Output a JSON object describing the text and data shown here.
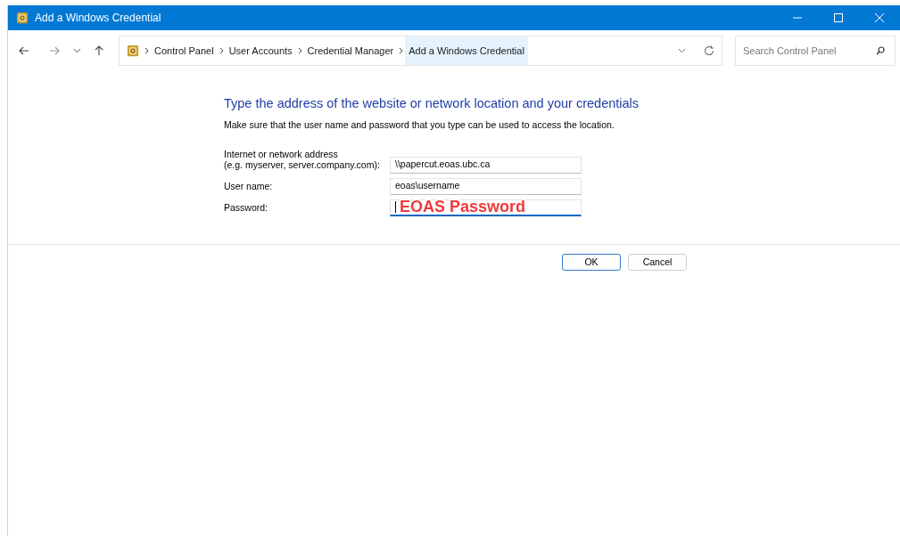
{
  "window": {
    "title": "Add a Windows Credential"
  },
  "breadcrumb": [
    {
      "label": "Control Panel",
      "selected": false
    },
    {
      "label": "User Accounts",
      "selected": false
    },
    {
      "label": "Credential Manager",
      "selected": false
    },
    {
      "label": "Add a Windows Credential",
      "selected": true
    }
  ],
  "search": {
    "placeholder": "Search Control Panel"
  },
  "heading": "Type the address of the website or network location and your credentials",
  "instruction": "Make sure that the user name and password that you type can be used to access the location.",
  "fields": [
    {
      "label_lines": [
        "Internet or network address",
        "(e.g. myserver, server.company.com):"
      ],
      "value": "\\\\papercut.eoas.ubc.ca",
      "focused": false
    },
    {
      "label_lines": [
        "User name:"
      ],
      "value": "eoas\\username",
      "focused": false
    },
    {
      "label_lines": [
        "Password:"
      ],
      "focused": true,
      "annotation": "EOAS Password"
    }
  ],
  "buttons": [
    {
      "label": "OK",
      "default": true
    },
    {
      "label": "Cancel",
      "default": false
    }
  ]
}
